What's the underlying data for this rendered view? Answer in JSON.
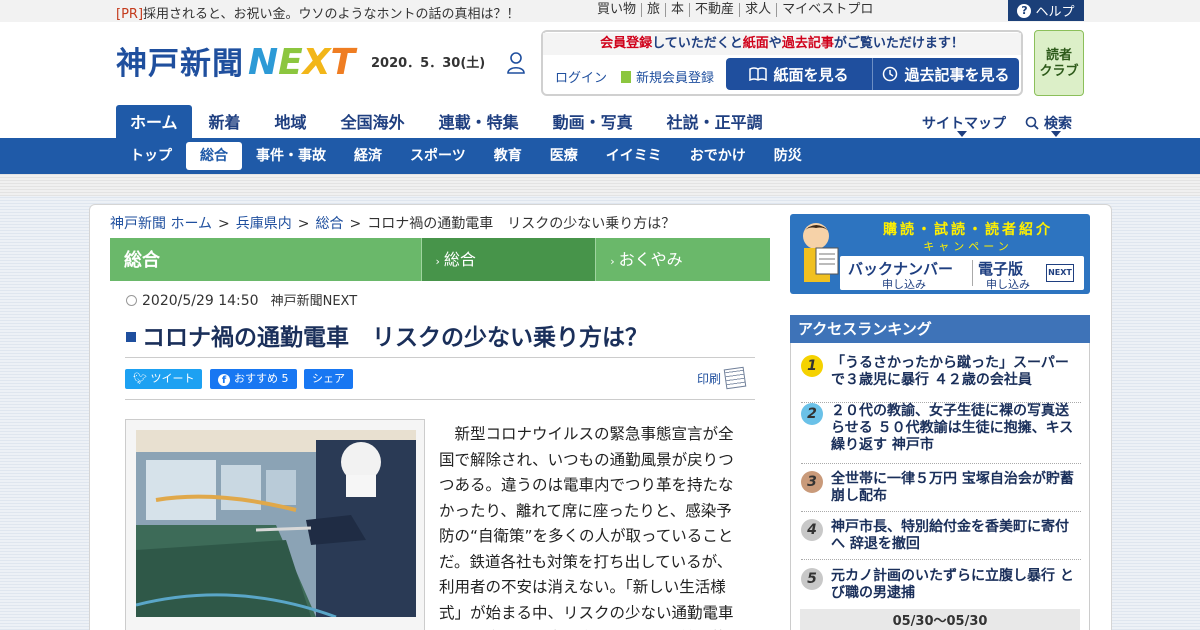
{
  "topbar": {
    "pr_tag": "[PR]",
    "pr_text": "採用されると、お祝い金。ウソのようなホントの話の真相は？！",
    "links": [
      "買い物",
      "旅",
      "本",
      "不動産",
      "求人",
      "マイベストプロ"
    ],
    "help": "ヘルプ"
  },
  "header": {
    "logo_text": "神戸新聞",
    "logo_next": [
      "N",
      "E",
      "X",
      "T"
    ],
    "date": "2020．5．30(土)",
    "member_msg_parts": [
      "会員登録",
      "していただくと",
      "紙面",
      "や",
      "過去記事",
      "がご覧いただけます！"
    ],
    "login": "ログイン",
    "register": "新規会員登録",
    "view_paper": "紙面を見る",
    "view_archive": "過去記事を見る",
    "club": [
      "読者",
      "クラブ"
    ]
  },
  "main_nav": {
    "items": [
      "ホーム",
      "新着",
      "地域",
      "全国海外",
      "連載・特集",
      "動画・写真",
      "社説・正平調"
    ],
    "sitemap": "サイトマップ",
    "search": "検索"
  },
  "sub_nav": {
    "items": [
      "トップ",
      "総合",
      "事件・事故",
      "経済",
      "スポーツ",
      "教育",
      "医療",
      "イイミミ",
      "おでかけ",
      "防災"
    ],
    "active": 1
  },
  "breadcrumb": [
    "神戸新聞 ホーム",
    "兵庫県内",
    "総合",
    "コロナ禍の通勤電車　リスクの少ない乗り方は？"
  ],
  "category": {
    "title": "総合",
    "tabs": [
      "総合",
      "おくやみ"
    ]
  },
  "article": {
    "datetime": "2020/5/29 14:50",
    "source": "神戸新聞NEXT",
    "headline": "コロナ禍の通勤電車　リスクの少ない乗り方は？",
    "tweet": "ツイート",
    "fb_recommend": "おすすめ 5",
    "share": "シェア",
    "print": "印刷",
    "body": "新型コロナウイルスの緊急事態宣言が全国で解除され、いつもの通勤風景が戻りつつある。違うのは電車内でつり革を持たなかったり、離れて席に座ったりと、感染予防の“自衛策”を多くの人が取っていることだ。鉄道各社も対策を打ち出しているが、利用者の不安は消えない。「新しい生活様式」が始まる中、リスクの少ない通勤電車の乗り方とは。専門家に聞いた。（前川茂"
  },
  "sidebar": {
    "banner_title": "購読・試読・読者紹介",
    "banner_sub": "キャンペーン",
    "backnumber": "バックナンバー",
    "backnumber_sub": "申し込み",
    "epaper": "電子版",
    "epaper_sub": "申し込み",
    "next_badge": "NEXT",
    "ranking_title": "アクセスランキング",
    "ranking": [
      {
        "rank": "1",
        "title": "「うるさかったから蹴った」スーパーで３歳児に暴行 ４２歳の会社員"
      },
      {
        "rank": "2",
        "title": "２０代の教諭、女子生徒に裸の写真送らせる ５０代教諭は生徒に抱擁、キス繰り返す 神戸市"
      },
      {
        "rank": "3",
        "title": "全世帯に一律５万円 宝塚自治会が貯蓄崩し配布"
      },
      {
        "rank": "4",
        "title": "神戸市長、特別給付金を香美町に寄付へ 辞退を撤回"
      },
      {
        "rank": "5",
        "title": "元カノ計画のいたずらに立腹し暴行 とび職の男逮捕"
      }
    ],
    "period": "05/30～05/30"
  },
  "colors": {
    "brand_blue": "#1f5aa8",
    "category_green": "#6ab86a",
    "rank1": "#f5d200",
    "rank2": "#6ac1e8",
    "rank3": "#c99a7a",
    "rank_other": "#c8c8c8"
  }
}
